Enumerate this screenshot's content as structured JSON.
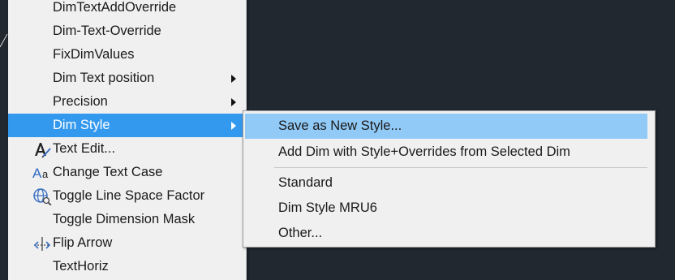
{
  "main_menu": {
    "items": [
      {
        "label": "DimTextAddOverride"
      },
      {
        "label": "Dim-Text-Override"
      },
      {
        "label": "FixDimValues"
      },
      {
        "label": "Dim Text position",
        "has_submenu": true
      },
      {
        "label": "Precision",
        "has_submenu": true
      },
      {
        "label": "Dim Style",
        "has_submenu": true,
        "highlighted": true
      },
      {
        "label": "Text Edit...",
        "icon": "text-edit-icon"
      },
      {
        "label": "Change Text Case",
        "icon": "change-case-icon"
      },
      {
        "label": "Toggle Line Space Factor",
        "icon": "line-space-icon"
      },
      {
        "label": "Toggle Dimension Mask"
      },
      {
        "label": "Flip Arrow",
        "icon": "flip-arrow-icon"
      },
      {
        "label": "TextHoriz"
      }
    ]
  },
  "dim_style_submenu": {
    "items": [
      {
        "label": "Save as New Style...",
        "highlighted": true
      },
      {
        "label": "Add Dim with Style+Overrides from Selected Dim"
      },
      {
        "label": "Standard"
      },
      {
        "label": "Dim Style MRU6"
      },
      {
        "label": "Other..."
      }
    ]
  },
  "colors": {
    "canvas_background": "#212830",
    "menu_background": "#f0f0f0",
    "menu_highlight": "#3399ee",
    "submenu_highlight": "#91c9f7"
  }
}
